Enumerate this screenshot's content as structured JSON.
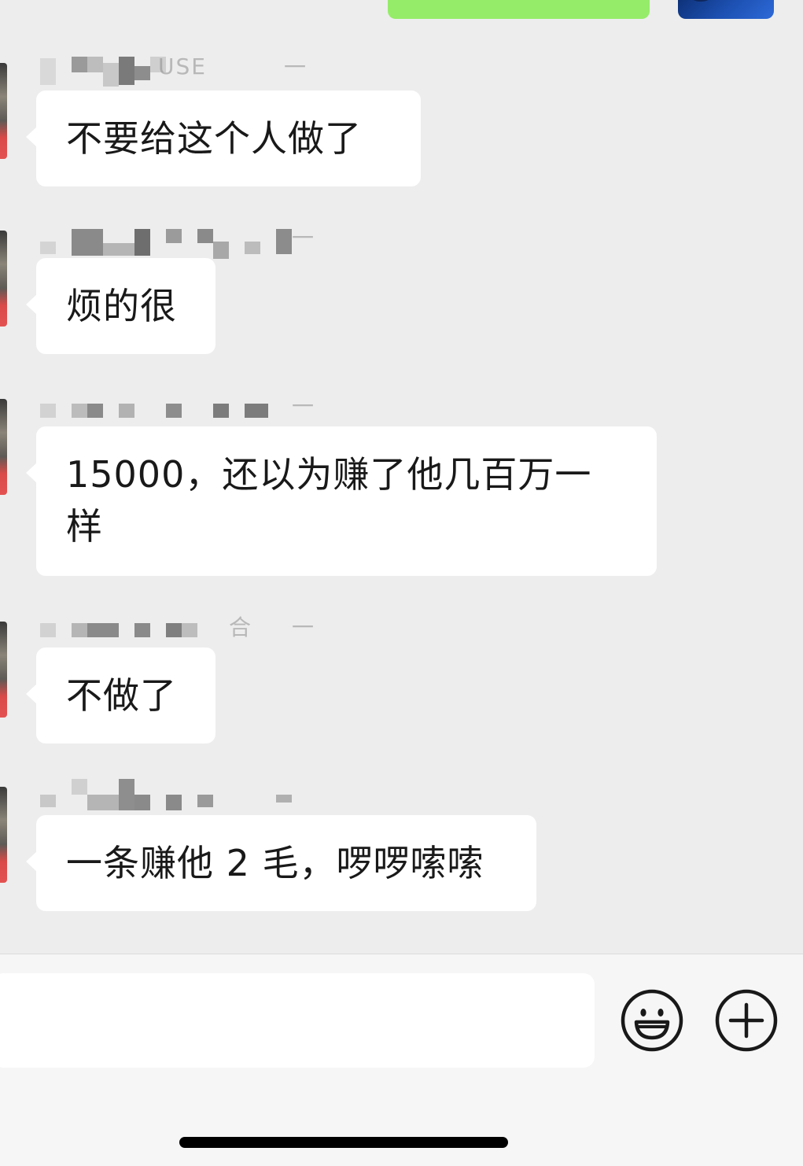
{
  "messages": [
    {
      "sender_visible": "USE",
      "sender_tail": "一",
      "text": "不要给这个人做了"
    },
    {
      "sender_visible": "",
      "sender_tail": "一",
      "text": "烦的很"
    },
    {
      "sender_visible": "",
      "sender_tail": "一",
      "text": "15000，还以为赚了他几百万一样"
    },
    {
      "sender_visible": "合",
      "sender_tail": "一",
      "text": "不做了"
    },
    {
      "sender_visible": "",
      "sender_tail": "",
      "text": "一条赚他 2 毛，啰啰嗦嗦"
    }
  ],
  "composer": {
    "emoji_icon": "smiley-face-icon",
    "more_icon": "plus-circle-icon"
  },
  "colors": {
    "background": "#ededed",
    "incoming_bubble": "#ffffff",
    "outgoing_bubble": "#95ec69",
    "text": "#191919"
  }
}
